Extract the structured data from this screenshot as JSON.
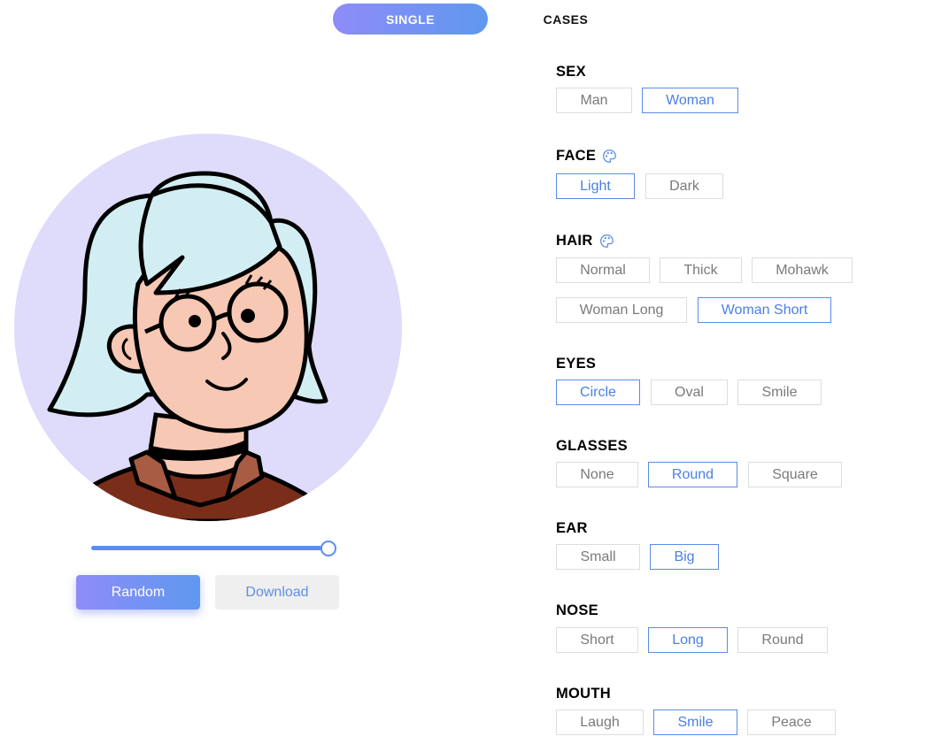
{
  "tabs": {
    "single": "SINGLE",
    "cases": "CASES"
  },
  "slider": {
    "value": 1.0
  },
  "actions": {
    "random": "Random",
    "download": "Download"
  },
  "accent_color": "#5a8be8",
  "avatar": {
    "background": "#dedbfb",
    "hair": "#d2eef2",
    "skin": "#f7c8b4",
    "shirt": "#7a2e1a",
    "collar": "#a85c44"
  },
  "groups": {
    "sex": {
      "title": "SEX",
      "options": [
        "Man",
        "Woman"
      ],
      "selected": 1
    },
    "face": {
      "title": "FACE",
      "icon": "palette-icon",
      "options": [
        "Light",
        "Dark"
      ],
      "selected": 0
    },
    "hair": {
      "title": "HAIR",
      "icon": "palette-icon",
      "options": [
        "Normal",
        "Thick",
        "Mohawk",
        "Woman Long",
        "Woman Short"
      ],
      "selected": 4
    },
    "eyes": {
      "title": "EYES",
      "options": [
        "Circle",
        "Oval",
        "Smile"
      ],
      "selected": 0
    },
    "glasses": {
      "title": "GLASSES",
      "options": [
        "None",
        "Round",
        "Square"
      ],
      "selected": 1
    },
    "ear": {
      "title": "EAR",
      "options": [
        "Small",
        "Big"
      ],
      "selected": 1
    },
    "nose": {
      "title": "NOSE",
      "options": [
        "Short",
        "Long",
        "Round"
      ],
      "selected": 1
    },
    "mouth": {
      "title": "MOUTH",
      "options": [
        "Laugh",
        "Smile",
        "Peace"
      ],
      "selected": 1
    }
  }
}
